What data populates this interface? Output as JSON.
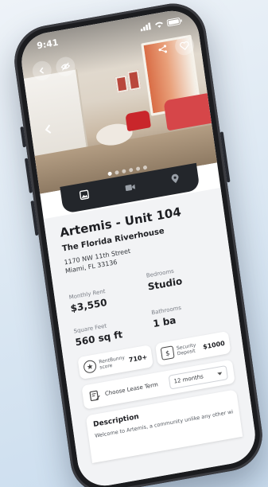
{
  "status_bar": {
    "time": "9:41"
  },
  "gallery": {
    "dot_count": 6,
    "active_dot": 0
  },
  "media_tabs": [
    {
      "name": "photos",
      "icon": "image-icon",
      "active": true
    },
    {
      "name": "video",
      "icon": "video-icon",
      "active": false
    },
    {
      "name": "map",
      "icon": "map-pin-icon",
      "active": false
    }
  ],
  "listing": {
    "title": "Artemis - Unit 104",
    "community": "The Florida Riverhouse",
    "address_line1": "1170 NW 11th Street",
    "address_line2": "Miami, FL 33136"
  },
  "stats": {
    "rent_label": "Monthly Rent",
    "rent_value": "$3,550",
    "bedrooms_label": "Bedrooms",
    "bedrooms_value": "Studio",
    "sqft_label": "Square Feet",
    "sqft_value": "560 sq ft",
    "bathrooms_label": "Bathrooms",
    "bathrooms_value": "1 ba"
  },
  "chips": {
    "score_label": "RentBunny score",
    "score_value": "710+",
    "deposit_label": "Security Deposit",
    "deposit_value": "$1000"
  },
  "lease": {
    "label": "Choose Lease Term",
    "selected": "12 months"
  },
  "description": {
    "title": "Description",
    "text": "Welcome to Artemis, a community unlike any other with"
  },
  "colors": {
    "dark_bar": "#23262b",
    "content_bg": "#f2f3f5",
    "sofa_red": "#c9262b"
  }
}
